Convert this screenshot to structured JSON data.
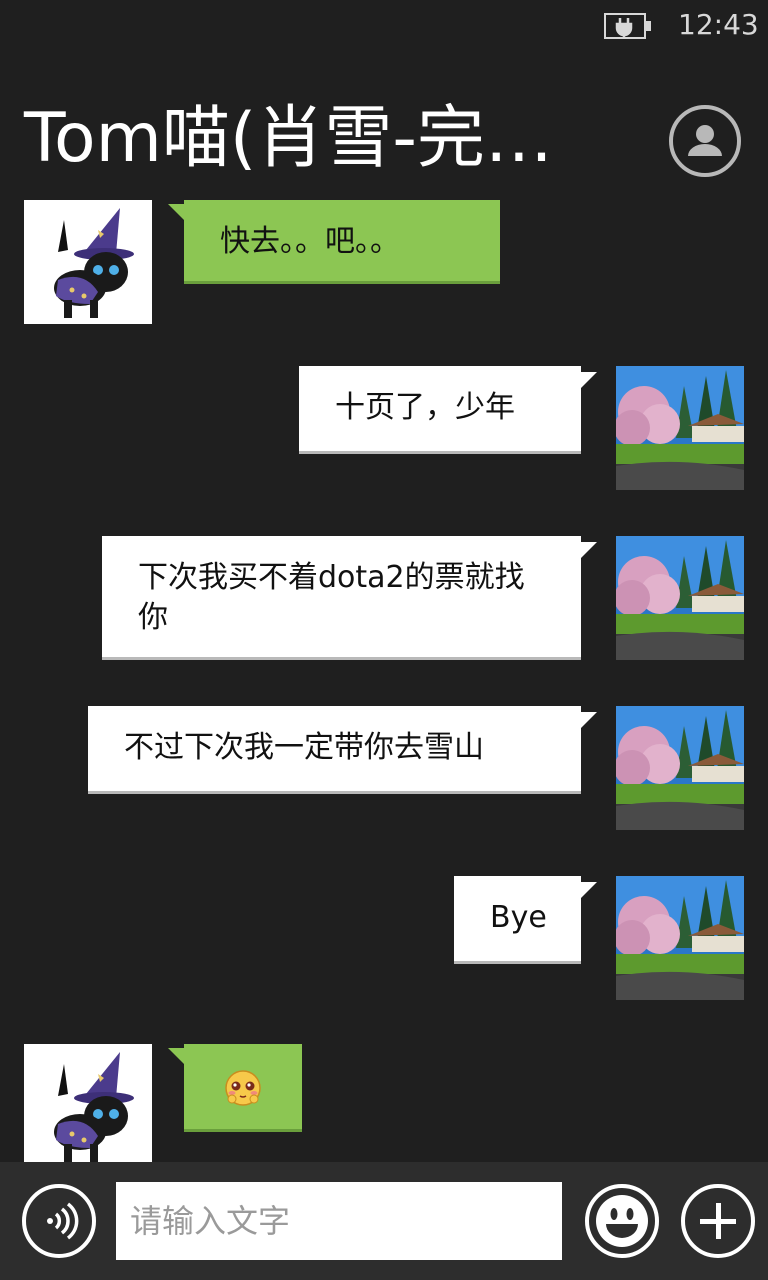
{
  "status": {
    "time": "12:43",
    "battery_icon": "battery-charging-icon"
  },
  "header": {
    "title": "Tom喵(肖雪-完…",
    "profile_icon": "profile-icon"
  },
  "messages": [
    {
      "direction": "incoming",
      "text": "快去。。吧。。"
    },
    {
      "direction": "outgoing",
      "text": "十页了，少年"
    },
    {
      "direction": "outgoing",
      "text": "下次我买不着dota2的票就找你"
    },
    {
      "direction": "outgoing",
      "text": "不过下次我一定带你去雪山"
    },
    {
      "direction": "outgoing",
      "text": "Bye"
    },
    {
      "direction": "incoming",
      "emoji": "shy-face-emoji"
    }
  ],
  "input_bar": {
    "placeholder": "请输入文字",
    "voice_icon": "voice-icon",
    "emoji_icon": "smiley-icon",
    "add_icon": "plus-icon"
  },
  "colors": {
    "background": "#1f1f1f",
    "incoming_bubble": "#8cc653",
    "outgoing_bubble": "#ffffff"
  }
}
